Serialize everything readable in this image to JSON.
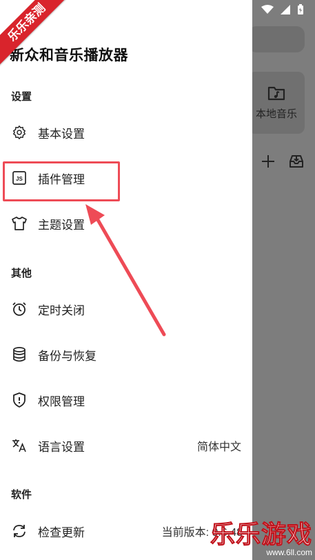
{
  "drawer": {
    "title": "新众和音乐播放器",
    "sections": {
      "settings": "设置",
      "others": "其他",
      "software": "软件"
    },
    "items": {
      "basic_settings": "基本设置",
      "plugin_management": "插件管理",
      "theme_settings": "主题设置",
      "sleep_timer": "定时关闭",
      "backup_restore": "备份与恢复",
      "permission_management": "权限管理",
      "language_settings": "语言设置",
      "language_value": "简体中文",
      "check_update": "检查更新",
      "version_value": "当前版本: 0.6.48"
    }
  },
  "background": {
    "card_label": "本地音乐"
  },
  "watermark": {
    "ribbon": "乐乐亲测",
    "brand": "乐乐游戏",
    "site": "www.6ll.com"
  },
  "colors": {
    "highlight": "#ee4b56",
    "ribbon": "#d9242c"
  }
}
